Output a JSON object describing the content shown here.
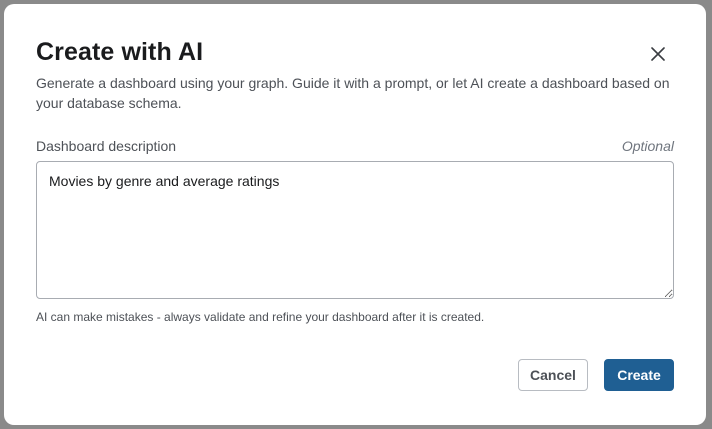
{
  "dialog": {
    "title": "Create with AI",
    "subtitle": "Generate a dashboard using your graph. Guide it with a prompt, or let AI create a dashboard based on your database schema.",
    "close_icon": "close-icon"
  },
  "description_field": {
    "label": "Dashboard description",
    "optional_label": "Optional",
    "value": "Movies by genre and average ratings"
  },
  "disclaimer": "AI can make mistakes - always validate and refine your dashboard after it is created.",
  "buttons": {
    "cancel_label": "Cancel",
    "create_label": "Create"
  },
  "colors": {
    "primary": "#1f5f93",
    "backdrop": "#8a8a8a",
    "text": "#1a1b1d"
  }
}
